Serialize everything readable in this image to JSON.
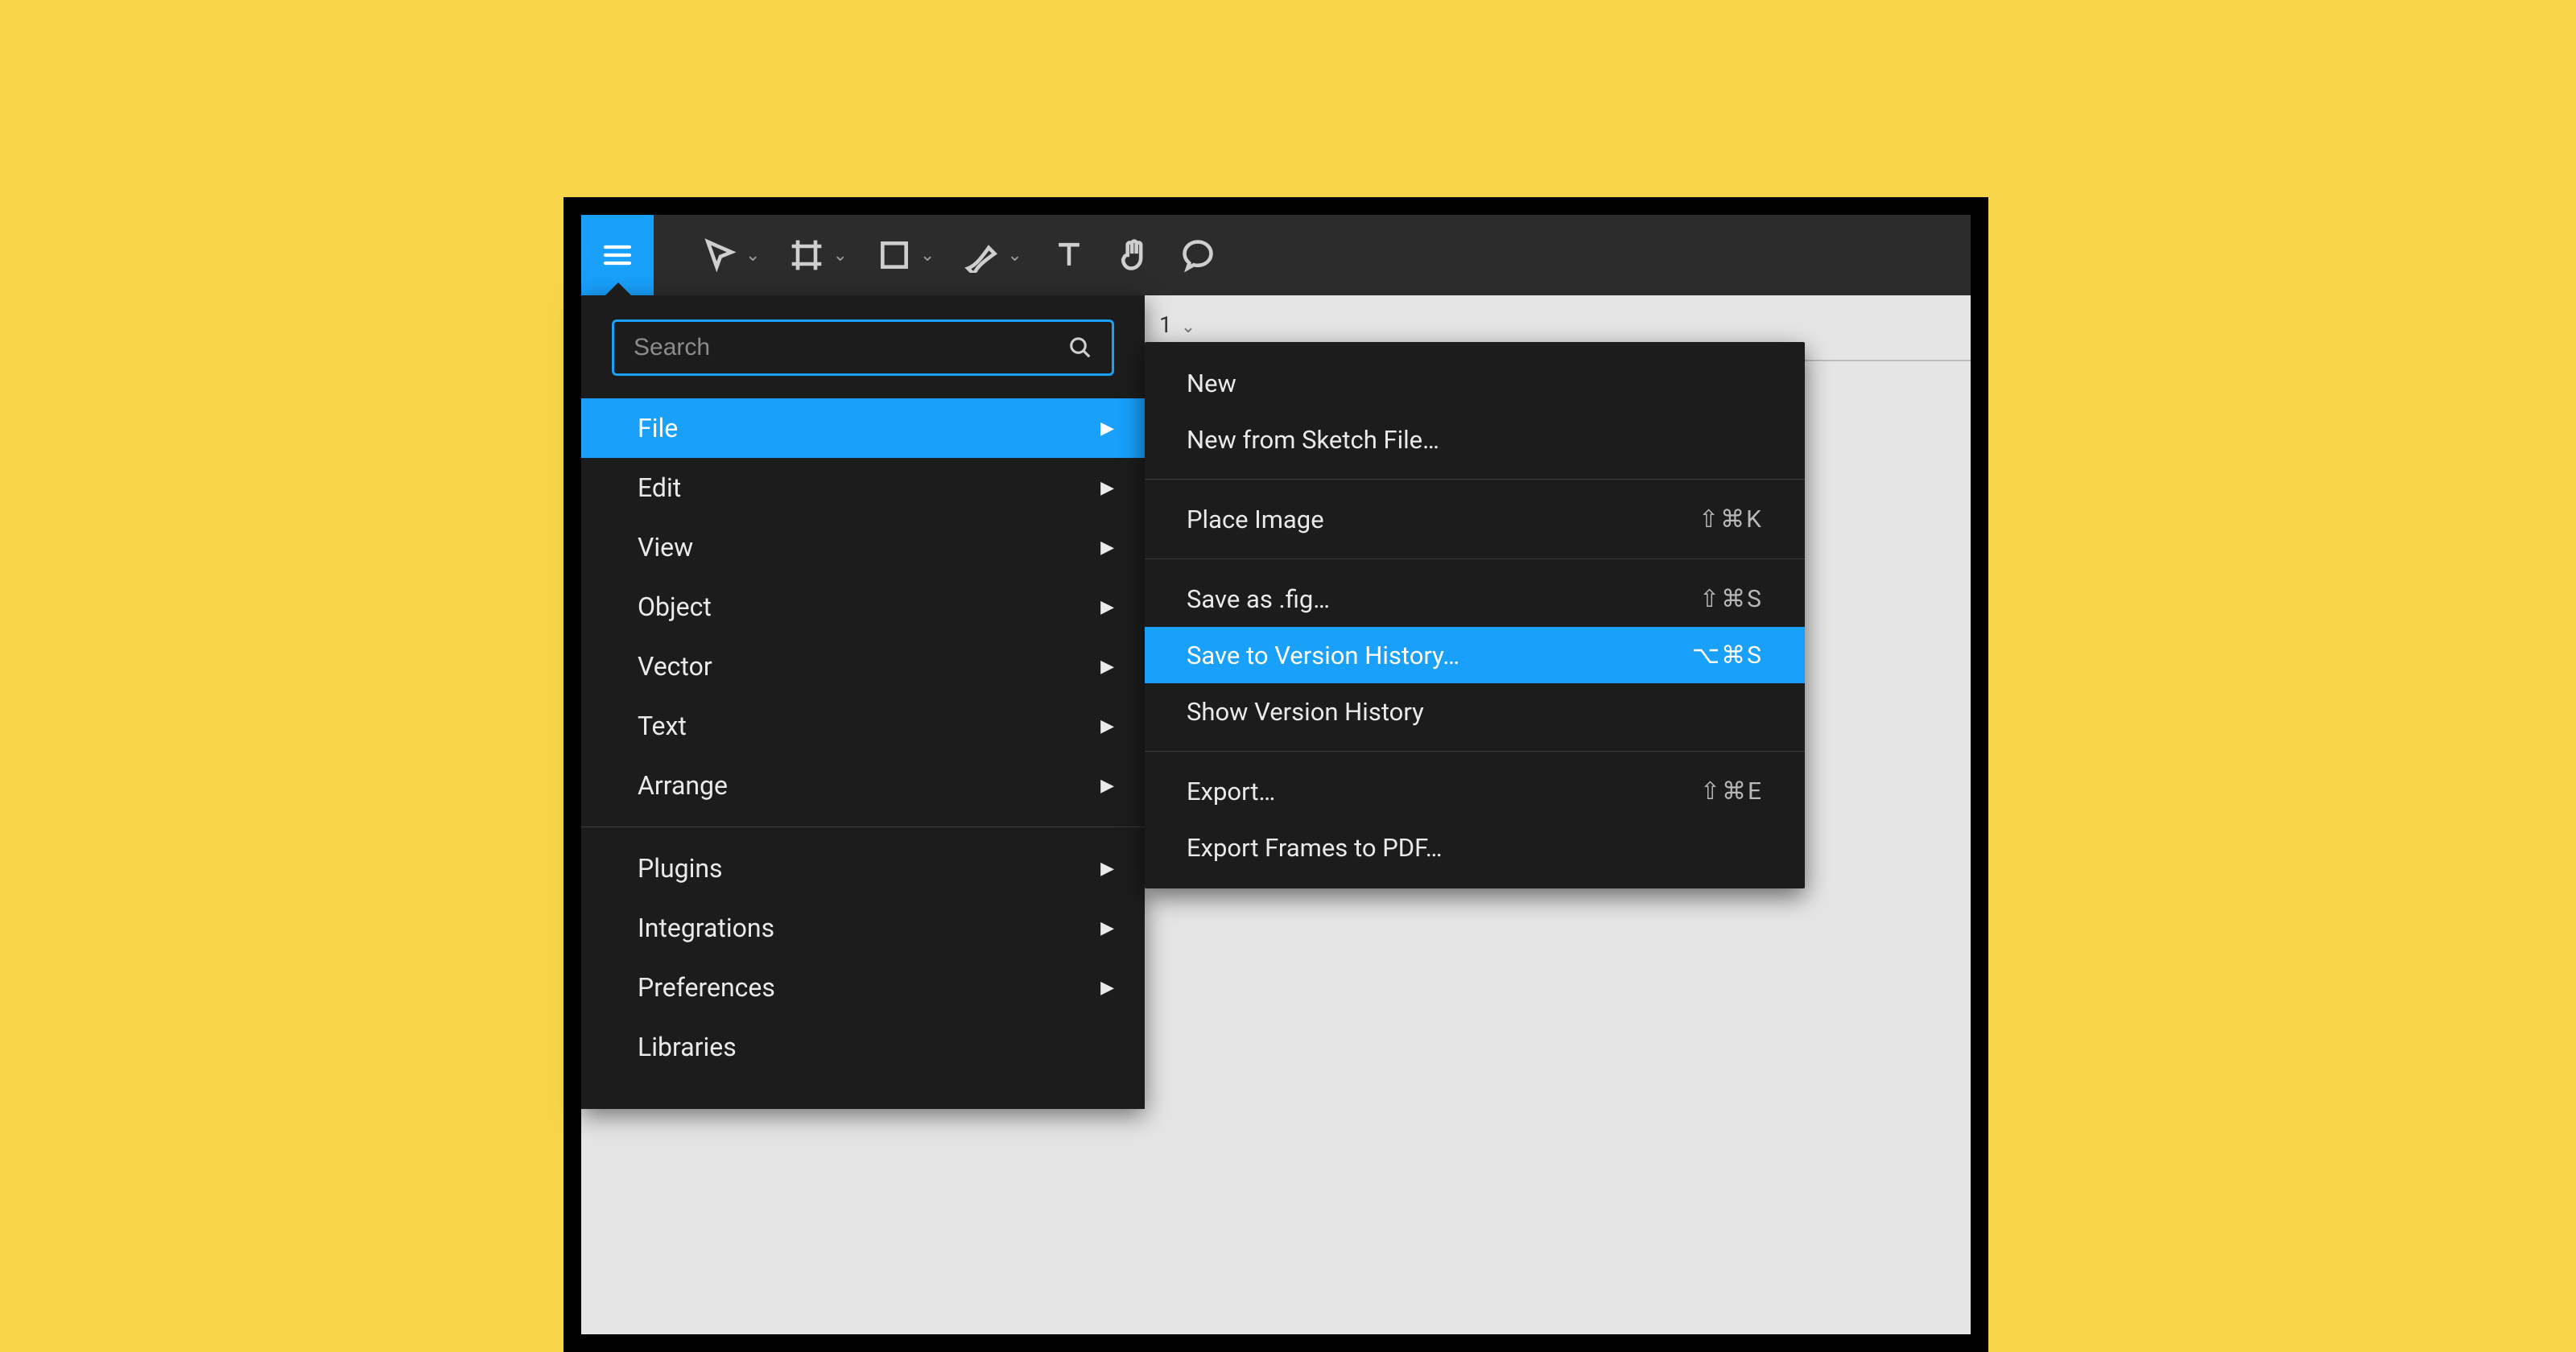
{
  "toolbar": {
    "tools": [
      "move",
      "frame",
      "rect",
      "pen",
      "text",
      "hand",
      "comment"
    ]
  },
  "tab": {
    "suffix": "1"
  },
  "search": {
    "placeholder": "Search"
  },
  "menu": {
    "groups": [
      [
        {
          "label": "File",
          "hasSub": true,
          "highlight": true
        },
        {
          "label": "Edit",
          "hasSub": true,
          "highlight": false
        },
        {
          "label": "View",
          "hasSub": true,
          "highlight": false
        },
        {
          "label": "Object",
          "hasSub": true,
          "highlight": false
        },
        {
          "label": "Vector",
          "hasSub": true,
          "highlight": false
        },
        {
          "label": "Text",
          "hasSub": true,
          "highlight": false
        },
        {
          "label": "Arrange",
          "hasSub": true,
          "highlight": false
        }
      ],
      [
        {
          "label": "Plugins",
          "hasSub": true,
          "highlight": false
        },
        {
          "label": "Integrations",
          "hasSub": true,
          "highlight": false
        },
        {
          "label": "Preferences",
          "hasSub": true,
          "highlight": false
        },
        {
          "label": "Libraries",
          "hasSub": false,
          "highlight": false
        }
      ]
    ]
  },
  "submenu": {
    "groups": [
      [
        {
          "label": "New",
          "shortcut": "",
          "highlight": false
        },
        {
          "label": "New from Sketch File…",
          "shortcut": "",
          "highlight": false
        }
      ],
      [
        {
          "label": "Place Image",
          "shortcut": "⇧⌘K",
          "highlight": false
        }
      ],
      [
        {
          "label": "Save as .fig…",
          "shortcut": "⇧⌘S",
          "highlight": false
        },
        {
          "label": "Save to Version History…",
          "shortcut": "⌥⌘S",
          "highlight": true
        },
        {
          "label": "Show Version History",
          "shortcut": "",
          "highlight": false
        }
      ],
      [
        {
          "label": "Export…",
          "shortcut": "⇧⌘E",
          "highlight": false
        },
        {
          "label": "Export Frames to PDF…",
          "shortcut": "",
          "highlight": false
        }
      ]
    ]
  }
}
